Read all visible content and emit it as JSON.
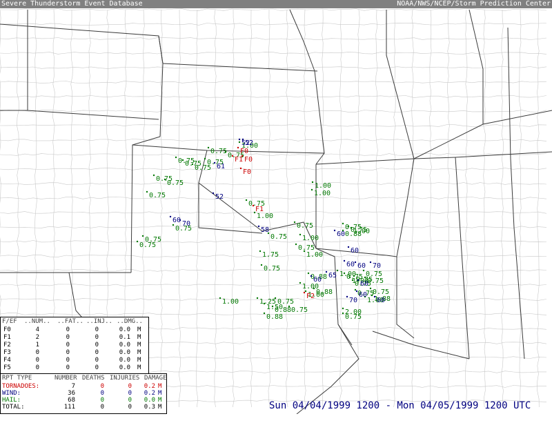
{
  "header": {
    "left_title": "Severe Thunderstorm Event Database",
    "right_title": "NOAA/NWS/NCEP/Storm Prediction Center"
  },
  "colors": {
    "tornado": "#cc0000",
    "wind": "#000080",
    "hail": "#007700",
    "state_line": "#333333",
    "county_line": "#c0c0c0"
  },
  "fscale_table": {
    "headers": [
      "F/EF",
      "..NUM..",
      "..FAT..",
      "..INJ..",
      "..DMG.."
    ],
    "rows": [
      {
        "f": "F0",
        "num": "4",
        "fat": "0",
        "inj": "0",
        "dmg": "0.0",
        "unit": "M"
      },
      {
        "f": "F1",
        "num": "2",
        "fat": "0",
        "inj": "0",
        "dmg": "0.1",
        "unit": "M"
      },
      {
        "f": "F2",
        "num": "1",
        "fat": "0",
        "inj": "0",
        "dmg": "0.0",
        "unit": "M"
      },
      {
        "f": "F3",
        "num": "0",
        "fat": "0",
        "inj": "0",
        "dmg": "0.0",
        "unit": "M"
      },
      {
        "f": "F4",
        "num": "0",
        "fat": "0",
        "inj": "0",
        "dmg": "0.0",
        "unit": "M"
      },
      {
        "f": "F5",
        "num": "0",
        "fat": "0",
        "inj": "0",
        "dmg": "0.0",
        "unit": "M"
      }
    ]
  },
  "report_table": {
    "headers": [
      "RPT TYPE",
      "NUMBER",
      "DEATHS",
      "INJURIES",
      "DAMAGE"
    ],
    "rows": [
      {
        "type": "TORNADOES:",
        "number": "7",
        "deaths": "0",
        "injuries": "0",
        "damage": "0.2",
        "unit": "M",
        "color": "#cc0000"
      },
      {
        "type": "WIND:",
        "number": "36",
        "deaths": "0",
        "injuries": "0",
        "damage": "0.2",
        "unit": "M",
        "color": "#000080"
      },
      {
        "type": "HAIL:",
        "number": "68",
        "deaths": "0",
        "injuries": "0",
        "damage": "0.0",
        "unit": "M",
        "color": "#007700"
      },
      {
        "type": "TOTAL:",
        "number": "111",
        "deaths": "0",
        "injuries": "0",
        "damage": "0.3",
        "unit": "M",
        "color": "#000000"
      }
    ]
  },
  "period_text": "Sun 04/04/1999 1200 - Mon 04/05/1999 1200 UTC",
  "reports": {
    "tornado": [
      "F0",
      "F0",
      "F0",
      "F1",
      "F1",
      "F2",
      "F0"
    ],
    "wind": [
      "52",
      "52",
      "61",
      "52",
      "60",
      "70",
      "58",
      "60",
      "70",
      "60",
      "65",
      "60",
      "70",
      "60",
      "65",
      "70",
      "60",
      "60",
      "60"
    ],
    "hail": [
      "0.75",
      "1.00",
      "1.75",
      "0.88",
      "1.25",
      "1.50",
      "2.00",
      "1.88"
    ]
  }
}
